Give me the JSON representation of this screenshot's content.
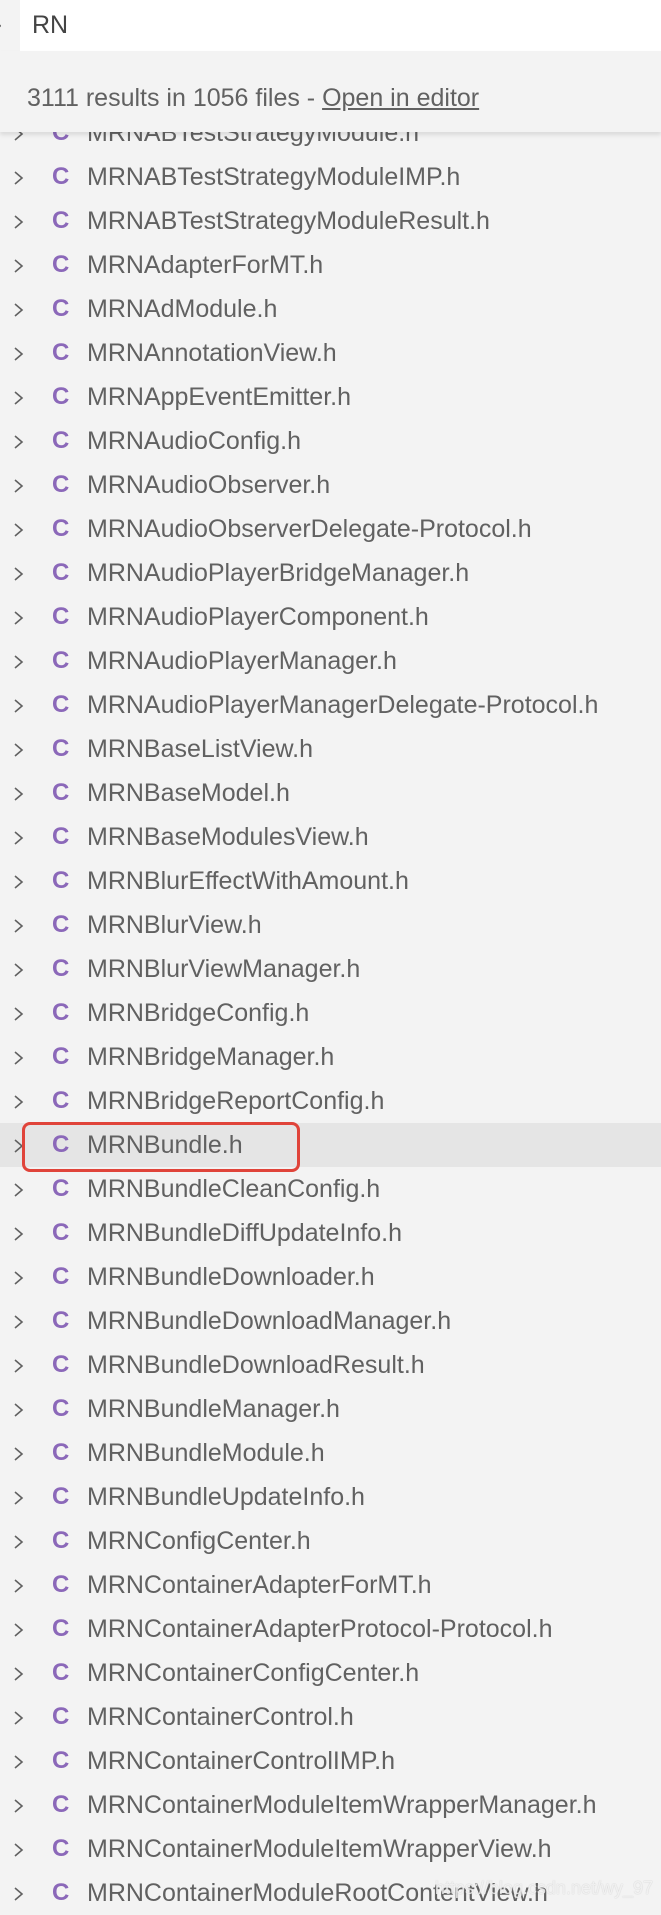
{
  "search": {
    "value": "RN"
  },
  "summary": {
    "text": "3111 results in 1056 files - ",
    "link": "Open in editor"
  },
  "colors": {
    "file_icon": "#8b68b9",
    "highlight_box": "#e0443a",
    "selected_row": "#e5e5e5"
  },
  "file_icon_glyph": "C",
  "selected_index": 23,
  "files": [
    "MRNABTestStrategyModule.h",
    "MRNABTestStrategyModuleIMP.h",
    "MRNABTestStrategyModuleResult.h",
    "MRNAdapterForMT.h",
    "MRNAdModule.h",
    "MRNAnnotationView.h",
    "MRNAppEventEmitter.h",
    "MRNAudioConfig.h",
    "MRNAudioObserver.h",
    "MRNAudioObserverDelegate-Protocol.h",
    "MRNAudioPlayerBridgeManager.h",
    "MRNAudioPlayerComponent.h",
    "MRNAudioPlayerManager.h",
    "MRNAudioPlayerManagerDelegate-Protocol.h",
    "MRNBaseListView.h",
    "MRNBaseModel.h",
    "MRNBaseModulesView.h",
    "MRNBlurEffectWithAmount.h",
    "MRNBlurView.h",
    "MRNBlurViewManager.h",
    "MRNBridgeConfig.h",
    "MRNBridgeManager.h",
    "MRNBridgeReportConfig.h",
    "MRNBundle.h",
    "MRNBundleCleanConfig.h",
    "MRNBundleDiffUpdateInfo.h",
    "MRNBundleDownloader.h",
    "MRNBundleDownloadManager.h",
    "MRNBundleDownloadResult.h",
    "MRNBundleManager.h",
    "MRNBundleModule.h",
    "MRNBundleUpdateInfo.h",
    "MRNConfigCenter.h",
    "MRNContainerAdapterForMT.h",
    "MRNContainerAdapterProtocol-Protocol.h",
    "MRNContainerConfigCenter.h",
    "MRNContainerControl.h",
    "MRNContainerControlIMP.h",
    "MRNContainerModuleItemWrapperManager.h",
    "MRNContainerModuleItemWrapperView.h",
    "MRNContainerModuleRootContentView.h"
  ],
  "watermark": "https://blog.csdn.net/wy_97"
}
